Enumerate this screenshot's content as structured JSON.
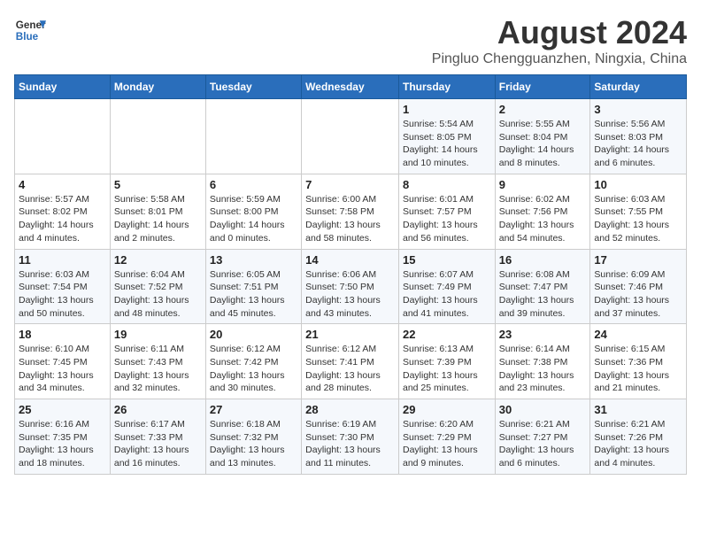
{
  "header": {
    "logo_line1": "General",
    "logo_line2": "Blue",
    "title": "August 2024",
    "subtitle": "Pingluo Chengguanzhen, Ningxia, China"
  },
  "days_of_week": [
    "Sunday",
    "Monday",
    "Tuesday",
    "Wednesday",
    "Thursday",
    "Friday",
    "Saturday"
  ],
  "weeks": [
    [
      {
        "day": "",
        "info": ""
      },
      {
        "day": "",
        "info": ""
      },
      {
        "day": "",
        "info": ""
      },
      {
        "day": "",
        "info": ""
      },
      {
        "day": "1",
        "info": "Sunrise: 5:54 AM\nSunset: 8:05 PM\nDaylight: 14 hours and 10 minutes."
      },
      {
        "day": "2",
        "info": "Sunrise: 5:55 AM\nSunset: 8:04 PM\nDaylight: 14 hours and 8 minutes."
      },
      {
        "day": "3",
        "info": "Sunrise: 5:56 AM\nSunset: 8:03 PM\nDaylight: 14 hours and 6 minutes."
      }
    ],
    [
      {
        "day": "4",
        "info": "Sunrise: 5:57 AM\nSunset: 8:02 PM\nDaylight: 14 hours and 4 minutes."
      },
      {
        "day": "5",
        "info": "Sunrise: 5:58 AM\nSunset: 8:01 PM\nDaylight: 14 hours and 2 minutes."
      },
      {
        "day": "6",
        "info": "Sunrise: 5:59 AM\nSunset: 8:00 PM\nDaylight: 14 hours and 0 minutes."
      },
      {
        "day": "7",
        "info": "Sunrise: 6:00 AM\nSunset: 7:58 PM\nDaylight: 13 hours and 58 minutes."
      },
      {
        "day": "8",
        "info": "Sunrise: 6:01 AM\nSunset: 7:57 PM\nDaylight: 13 hours and 56 minutes."
      },
      {
        "day": "9",
        "info": "Sunrise: 6:02 AM\nSunset: 7:56 PM\nDaylight: 13 hours and 54 minutes."
      },
      {
        "day": "10",
        "info": "Sunrise: 6:03 AM\nSunset: 7:55 PM\nDaylight: 13 hours and 52 minutes."
      }
    ],
    [
      {
        "day": "11",
        "info": "Sunrise: 6:03 AM\nSunset: 7:54 PM\nDaylight: 13 hours and 50 minutes."
      },
      {
        "day": "12",
        "info": "Sunrise: 6:04 AM\nSunset: 7:52 PM\nDaylight: 13 hours and 48 minutes."
      },
      {
        "day": "13",
        "info": "Sunrise: 6:05 AM\nSunset: 7:51 PM\nDaylight: 13 hours and 45 minutes."
      },
      {
        "day": "14",
        "info": "Sunrise: 6:06 AM\nSunset: 7:50 PM\nDaylight: 13 hours and 43 minutes."
      },
      {
        "day": "15",
        "info": "Sunrise: 6:07 AM\nSunset: 7:49 PM\nDaylight: 13 hours and 41 minutes."
      },
      {
        "day": "16",
        "info": "Sunrise: 6:08 AM\nSunset: 7:47 PM\nDaylight: 13 hours and 39 minutes."
      },
      {
        "day": "17",
        "info": "Sunrise: 6:09 AM\nSunset: 7:46 PM\nDaylight: 13 hours and 37 minutes."
      }
    ],
    [
      {
        "day": "18",
        "info": "Sunrise: 6:10 AM\nSunset: 7:45 PM\nDaylight: 13 hours and 34 minutes."
      },
      {
        "day": "19",
        "info": "Sunrise: 6:11 AM\nSunset: 7:43 PM\nDaylight: 13 hours and 32 minutes."
      },
      {
        "day": "20",
        "info": "Sunrise: 6:12 AM\nSunset: 7:42 PM\nDaylight: 13 hours and 30 minutes."
      },
      {
        "day": "21",
        "info": "Sunrise: 6:12 AM\nSunset: 7:41 PM\nDaylight: 13 hours and 28 minutes."
      },
      {
        "day": "22",
        "info": "Sunrise: 6:13 AM\nSunset: 7:39 PM\nDaylight: 13 hours and 25 minutes."
      },
      {
        "day": "23",
        "info": "Sunrise: 6:14 AM\nSunset: 7:38 PM\nDaylight: 13 hours and 23 minutes."
      },
      {
        "day": "24",
        "info": "Sunrise: 6:15 AM\nSunset: 7:36 PM\nDaylight: 13 hours and 21 minutes."
      }
    ],
    [
      {
        "day": "25",
        "info": "Sunrise: 6:16 AM\nSunset: 7:35 PM\nDaylight: 13 hours and 18 minutes."
      },
      {
        "day": "26",
        "info": "Sunrise: 6:17 AM\nSunset: 7:33 PM\nDaylight: 13 hours and 16 minutes."
      },
      {
        "day": "27",
        "info": "Sunrise: 6:18 AM\nSunset: 7:32 PM\nDaylight: 13 hours and 13 minutes."
      },
      {
        "day": "28",
        "info": "Sunrise: 6:19 AM\nSunset: 7:30 PM\nDaylight: 13 hours and 11 minutes."
      },
      {
        "day": "29",
        "info": "Sunrise: 6:20 AM\nSunset: 7:29 PM\nDaylight: 13 hours and 9 minutes."
      },
      {
        "day": "30",
        "info": "Sunrise: 6:21 AM\nSunset: 7:27 PM\nDaylight: 13 hours and 6 minutes."
      },
      {
        "day": "31",
        "info": "Sunrise: 6:21 AM\nSunset: 7:26 PM\nDaylight: 13 hours and 4 minutes."
      }
    ]
  ]
}
